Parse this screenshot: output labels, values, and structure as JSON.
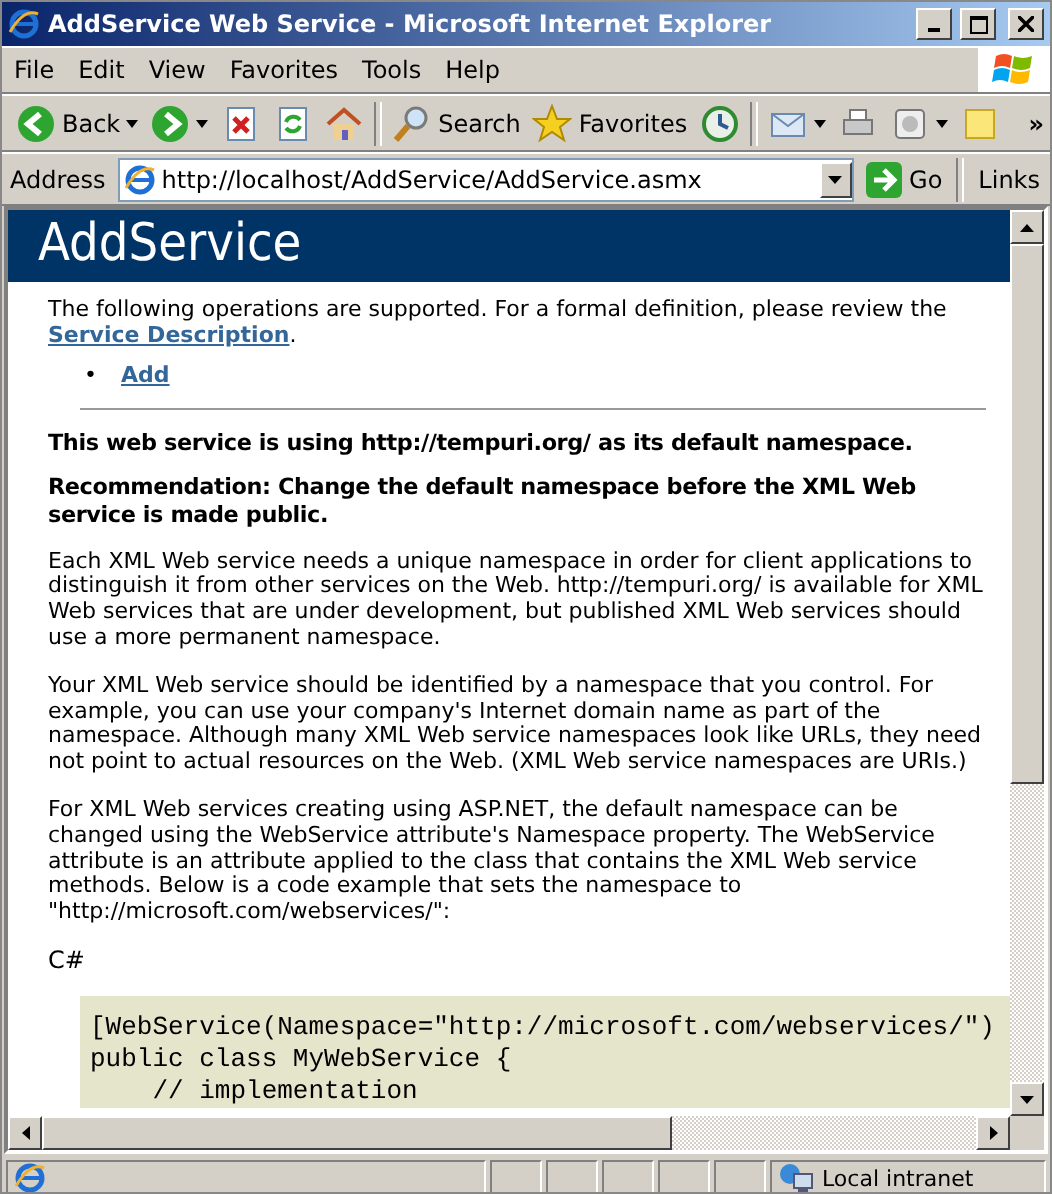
{
  "window": {
    "title": "AddService Web Service - Microsoft Internet Explorer"
  },
  "menu": [
    "File",
    "Edit",
    "View",
    "Favorites",
    "Tools",
    "Help"
  ],
  "toolbar": [
    {
      "kind": "back",
      "label": "Back"
    },
    {
      "kind": "forward"
    },
    {
      "kind": "stop"
    },
    {
      "kind": "refresh"
    },
    {
      "kind": "home"
    },
    {
      "kind": "search",
      "label": "Search"
    },
    {
      "kind": "favorites",
      "label": "Favorites"
    },
    {
      "kind": "history"
    },
    {
      "kind": "mail"
    },
    {
      "kind": "print"
    },
    {
      "kind": "edit"
    },
    {
      "kind": "note"
    }
  ],
  "toolbar_more": "»",
  "address_bar": {
    "label": "Address",
    "value": "http://localhost/AddService/AddService.asmx",
    "go": "Go",
    "links": "Links"
  },
  "page": {
    "heading": "AddService",
    "intro": "The following operations are supported. For a formal definition, please review the ",
    "intro_link": "Service Description",
    "intro_end": ".",
    "operations": [
      {
        "marker": "•",
        "label": "Add"
      }
    ],
    "namespace_notice": "This web service is using http://tempuri.org/ as its default namespace.",
    "recommendation": "Recommendation: Change the default namespace before the XML Web service is made public.",
    "paragraphs": [
      "Each XML Web service needs a unique namespace in order for client applications to distinguish it from other services on the Web. http://tempuri.org/ is available for XML Web services that are under development, but published XML Web services should use a more permanent namespace.",
      "Your XML Web service should be identified by a namespace that you control. For example, you can use your company's Internet domain name as part of the namespace. Although many XML Web service namespaces look like URLs, they need not point to actual resources on the Web. (XML Web service namespaces are URIs.)",
      "For XML Web services creating using ASP.NET, the default namespace can be changed using the WebService attribute's Namespace property. The WebService attribute is an attribute applied to the class that contains the XML Web service methods. Below is a code example that sets the namespace to \"http://microsoft.com/webservices/\":"
    ],
    "code_label": "C#",
    "code_lines": [
      "[WebService(Namespace=\"http://microsoft.com/webservices/\")",
      "public class MyWebService {",
      "    // implementation"
    ]
  },
  "status_bar": {
    "zone": "Local intranet"
  }
}
